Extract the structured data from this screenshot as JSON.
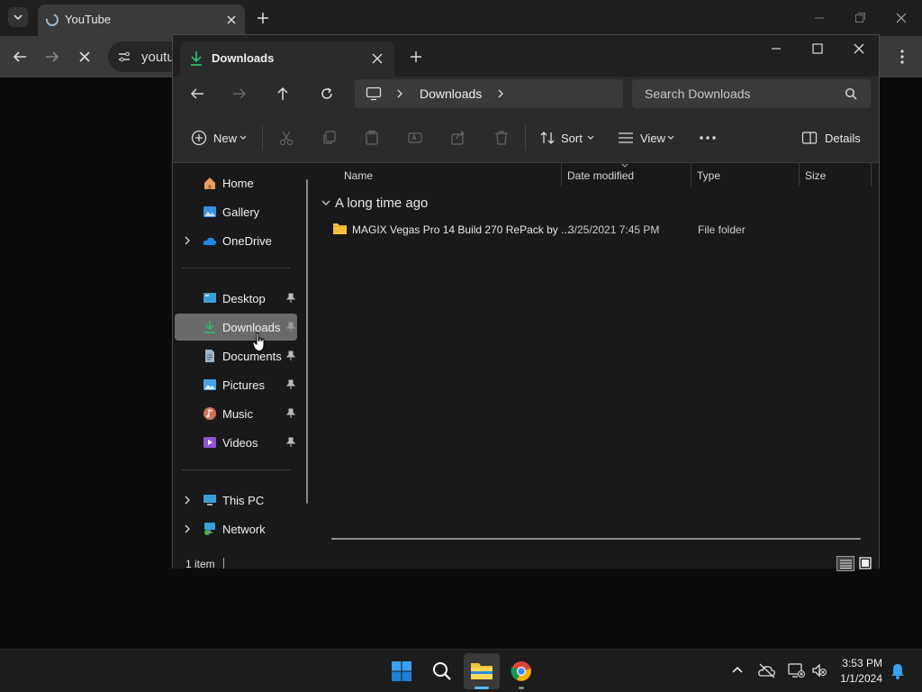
{
  "browser": {
    "tab_title": "YouTube",
    "omnibox_text": "youtu"
  },
  "explorer": {
    "tab_title": "Downloads",
    "breadcrumb": [
      "Downloads"
    ],
    "search_placeholder": "Search Downloads",
    "commands": {
      "new": "New",
      "sort": "Sort",
      "view": "View",
      "details": "Details"
    },
    "sidebar": {
      "top": [
        {
          "label": "Home",
          "icon": "home-icon"
        },
        {
          "label": "Gallery",
          "icon": "gallery-icon"
        },
        {
          "label": "OneDrive",
          "icon": "onedrive-icon"
        }
      ],
      "pinned": [
        {
          "label": "Desktop",
          "icon": "desktop-icon"
        },
        {
          "label": "Downloads",
          "icon": "downloads-icon"
        },
        {
          "label": "Documents",
          "icon": "documents-icon"
        },
        {
          "label": "Pictures",
          "icon": "pictures-icon"
        },
        {
          "label": "Music",
          "icon": "music-icon"
        },
        {
          "label": "Videos",
          "icon": "videos-icon"
        }
      ],
      "bottom": [
        {
          "label": "This PC",
          "icon": "this-pc-icon"
        },
        {
          "label": "Network",
          "icon": "network-icon"
        }
      ],
      "selected": "Downloads"
    },
    "columns": [
      "Name",
      "Date modified",
      "Type",
      "Size"
    ],
    "group_label": "A long time ago",
    "files": [
      {
        "name": "MAGIX Vegas Pro 14 Build 270 RePack by ...",
        "date": "3/25/2021 7:45 PM",
        "type": "File folder",
        "size": ""
      }
    ],
    "status": "1 item"
  },
  "taskbar": {
    "time": "3:53 PM",
    "date": "1/1/2024"
  },
  "colors": {
    "accent": "#0f7bd8",
    "folder": "#f4c33c",
    "download_green": "#2fb86c"
  }
}
